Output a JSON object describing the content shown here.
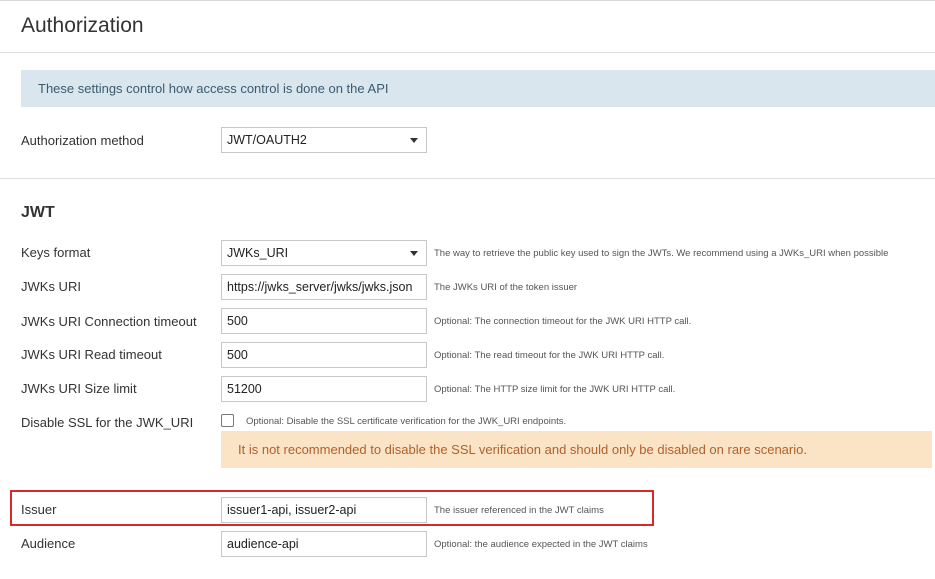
{
  "page": {
    "title": "Authorization"
  },
  "info_text": "These settings control how access control is done on the API",
  "auth_method": {
    "label": "Authorization method",
    "value": "JWT/OAUTH2"
  },
  "jwt": {
    "heading": "JWT",
    "keys_format": {
      "label": "Keys format",
      "value": "JWKs_URI",
      "help": "The way to retrieve the public key used to sign the JWTs. We recommend using a JWKs_URI when possible"
    },
    "jwks_uri": {
      "label": "JWKs URI",
      "value": "https://jwks_server/jwks/jwks.json",
      "help": "The JWKs URI of the token issuer"
    },
    "connection_timeout": {
      "label": "JWKs URI Connection timeout",
      "value": "500",
      "help": "Optional: The connection timeout for the JWK URI HTTP call."
    },
    "read_timeout": {
      "label": "JWKs URI Read timeout",
      "value": "500",
      "help": "Optional: The read timeout for the JWK URI HTTP call."
    },
    "size_limit": {
      "label": "JWKs URI Size limit",
      "value": "51200",
      "help": "Optional: The HTTP size limit for the JWK URI HTTP call."
    },
    "disable_ssl": {
      "label": "Disable SSL for the JWK_URI",
      "checked": false,
      "help": "Optional: Disable the SSL certificate verification for the JWK_URI endpoints.",
      "warning": "It is not recommended to disable the SSL verification and should only be disabled on rare scenario."
    },
    "issuer": {
      "label": "Issuer",
      "value": "issuer1-api, issuer2-api",
      "help": "The issuer referenced in the JWT claims"
    },
    "audience": {
      "label": "Audience",
      "value": "audience-api",
      "help": "Optional: the audience expected in the JWT claims"
    }
  },
  "colors": {
    "info_bg": "#d9e6ee",
    "warning_bg": "#fbe3c6",
    "warning_text": "#b1612a",
    "highlight": "#d22b2b"
  }
}
